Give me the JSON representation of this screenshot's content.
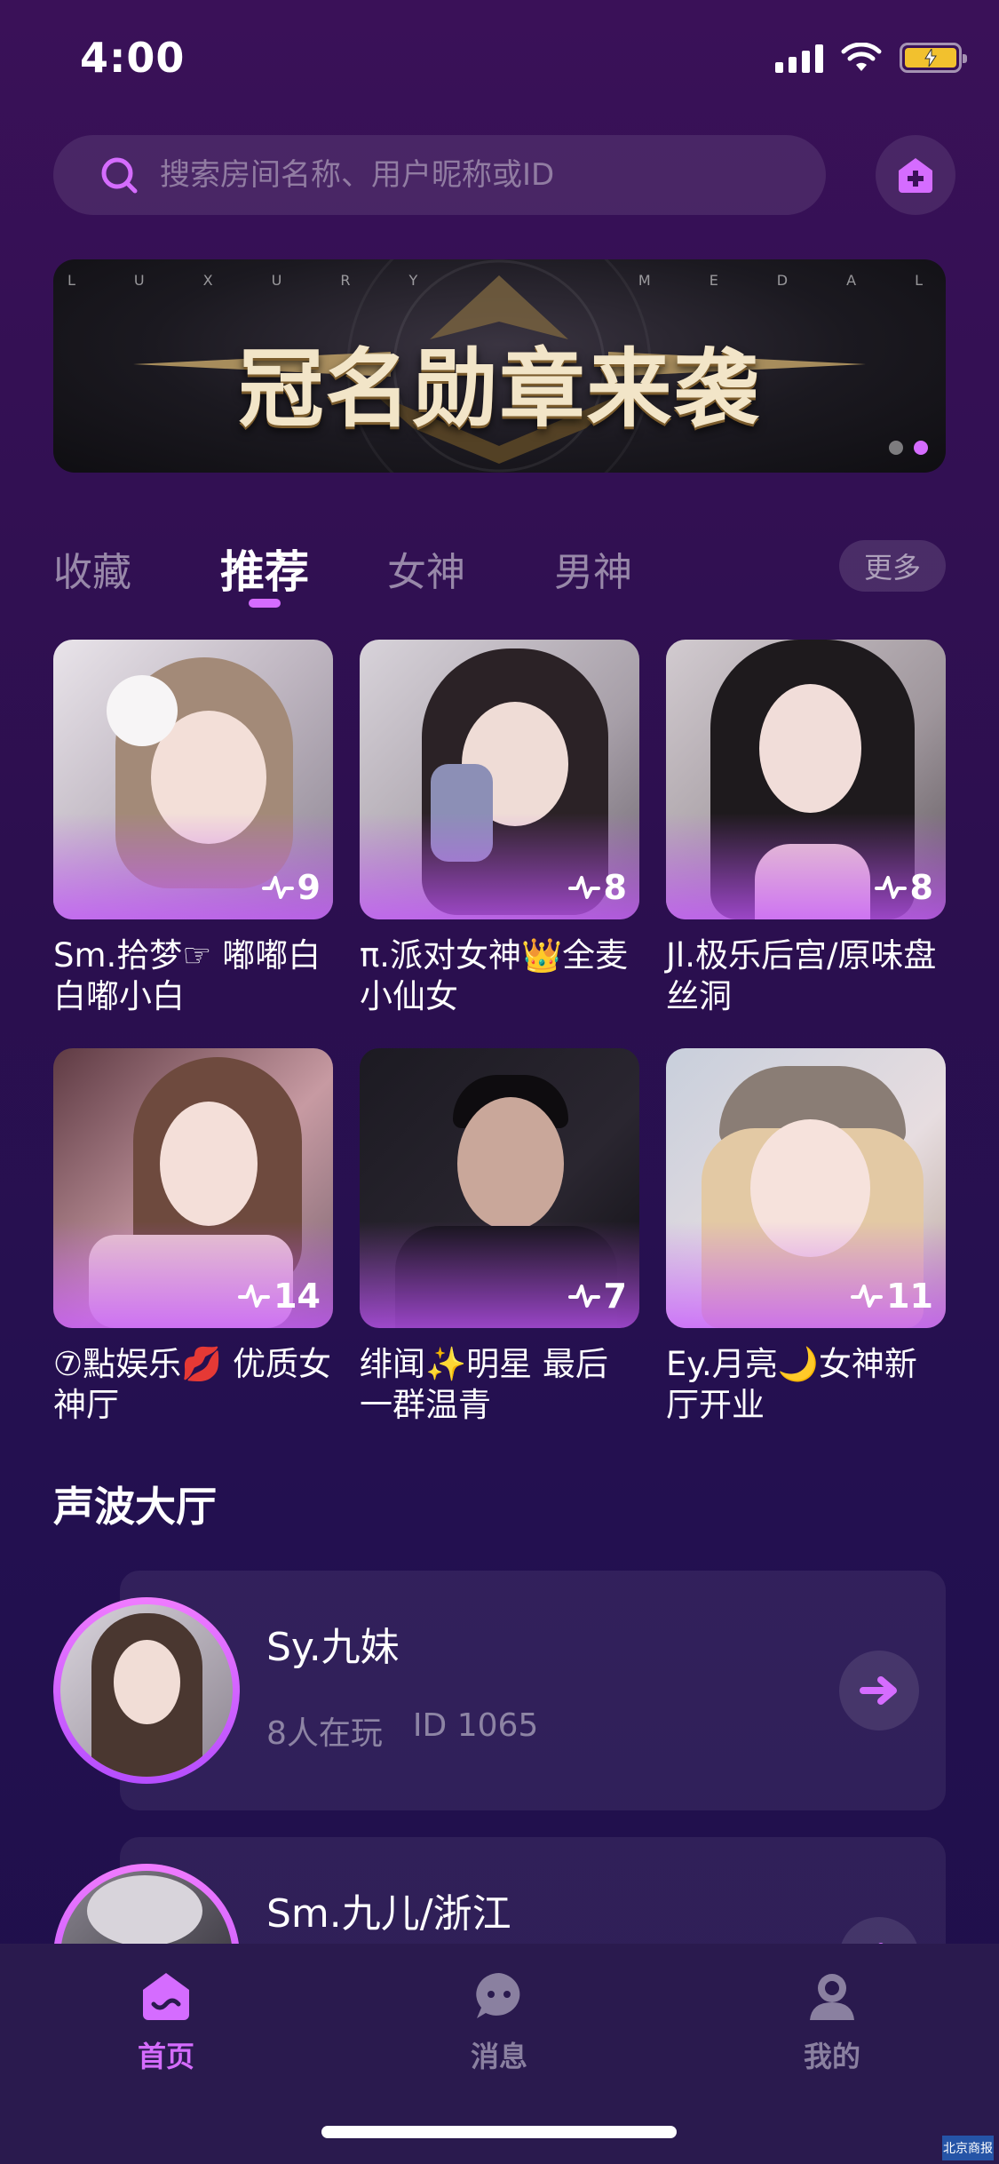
{
  "status_bar": {
    "time": "4:00",
    "icons": [
      "signal-icon",
      "wifi-icon",
      "battery-charging-icon"
    ],
    "battery_color": "#f2c12e"
  },
  "search": {
    "placeholder": "搜索房间名称、用户昵称或ID",
    "icon": "search-icon",
    "create_room_icon": "add-home-icon"
  },
  "banner": {
    "title": "冠名勋章来袭",
    "letters_left": [
      "L",
      "U",
      "X",
      "U",
      "R",
      "Y"
    ],
    "letters_right": [
      "M",
      "E",
      "D",
      "A",
      "L"
    ],
    "page_count": 2,
    "active_page": 2
  },
  "tabs": {
    "items": [
      "收藏",
      "推荐",
      "女神",
      "男神"
    ],
    "active": "推荐",
    "more_label": "更多"
  },
  "rooms": [
    {
      "title": "Sm.拾梦☞ 嘟嘟白白嘟小白",
      "heat": "9"
    },
    {
      "title": "π.派对女神👑全麦小仙女",
      "heat": "8"
    },
    {
      "title": "Jl.极乐后宫/原味盘丝洞",
      "heat": "8"
    },
    {
      "title": "⑦點娱乐💋 优质女神厅",
      "heat": "14"
    },
    {
      "title": "绯闻✨明星  最后一群温青",
      "heat": "7"
    },
    {
      "title": "Ey.月亮🌙女神新厅开业",
      "heat": "11"
    }
  ],
  "hall": {
    "section_title": "声波大厅",
    "items": [
      {
        "name": "Sy.九妹",
        "players": "8人在玩",
        "room_id": "ID 1065"
      },
      {
        "name": "Sm.九儿/浙江",
        "players": "",
        "room_id": ""
      }
    ]
  },
  "tabbar": {
    "items": [
      {
        "label": "首页",
        "icon": "home-icon",
        "active": true
      },
      {
        "label": "消息",
        "icon": "message-icon",
        "active": false
      },
      {
        "label": "我的",
        "icon": "profile-icon",
        "active": false
      }
    ],
    "active_color": "#d56cff",
    "inactive_color": "#8a80a0"
  },
  "watermark": "北京商报",
  "colors": {
    "accent": "#d56cff",
    "background_top": "#3a1158",
    "background_bottom": "#1f0f4a"
  }
}
